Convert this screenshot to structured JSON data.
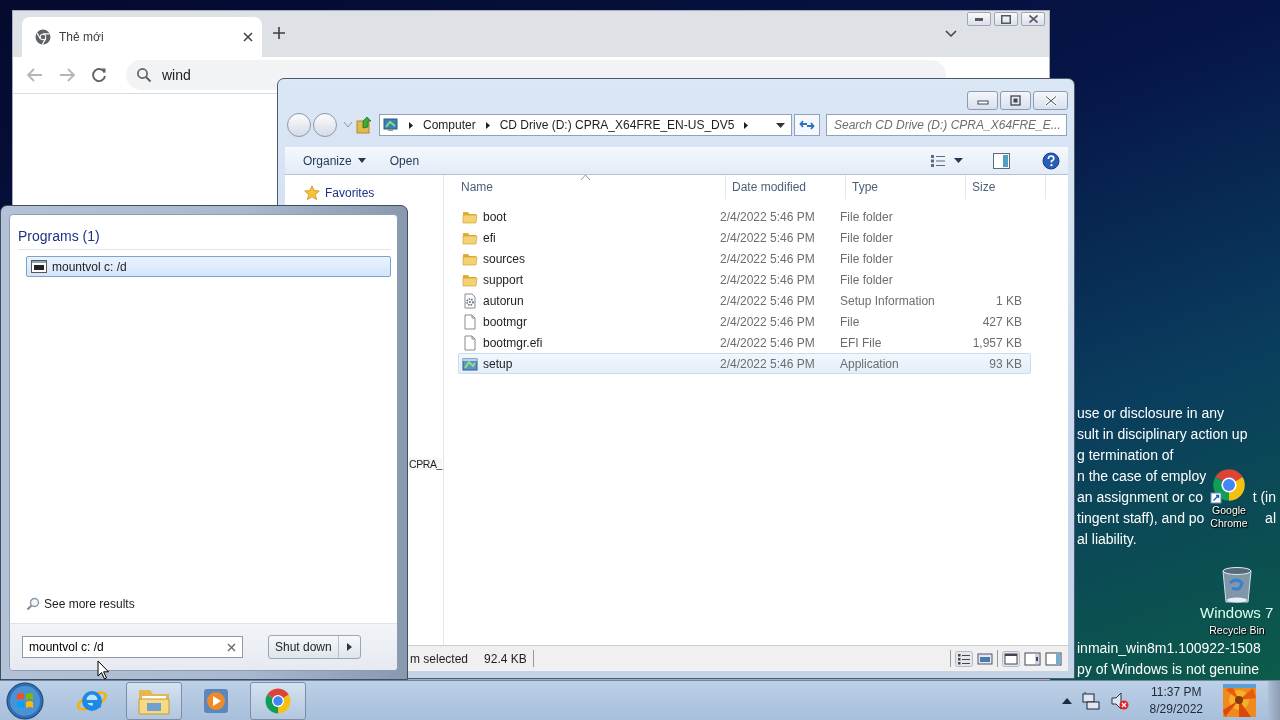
{
  "desktop": {
    "notice_lines": [
      [
        "use or disclosure in any"
      ],
      [
        "sult in disciplinary action up"
      ],
      [
        "g termination of"
      ],
      [
        "n the case of employ"
      ],
      [
        "an assignment or co",
        "t (in"
      ],
      [
        "tingent staff), and po",
        "al"
      ],
      [
        "al liability."
      ]
    ],
    "icons": [
      {
        "kind": "chrome",
        "label": "Google Chrome"
      },
      {
        "kind": "recycle-bin",
        "label": "Recycle Bin"
      }
    ],
    "edition": "Windows 7",
    "build_lines": [
      "inmain_win8m1.100922-1508",
      "py of Windows is not genuine"
    ]
  },
  "browser": {
    "tab_title": "Thẻ mới",
    "address": "wind"
  },
  "explorer": {
    "breadcrumbs": [
      "Computer",
      "CD Drive (D:) CPRA_X64FRE_EN-US_DV5"
    ],
    "search_placeholder": "Search CD Drive (D:) CPRA_X64FRE_E...",
    "commands": [
      {
        "label": "Organize",
        "menu": true
      },
      {
        "label": "Open",
        "menu": false
      }
    ],
    "nav_items": [
      "Favorites",
      "CPRA_"
    ],
    "columns": [
      "Name",
      "Date modified",
      "Type",
      "Size"
    ],
    "rows": [
      {
        "kind": "folder",
        "name": "boot",
        "date": "2/4/2022 5:46 PM",
        "type": "File folder",
        "selected": false
      },
      {
        "kind": "folder",
        "name": "efi",
        "date": "2/4/2022 5:46 PM",
        "type": "File folder",
        "selected": false
      },
      {
        "kind": "folder",
        "name": "sources",
        "date": "2/4/2022 5:46 PM",
        "type": "File folder",
        "selected": false
      },
      {
        "kind": "folder",
        "name": "support",
        "date": "2/4/2022 5:46 PM",
        "type": "File folder",
        "selected": false
      },
      {
        "kind": "settings",
        "name": "autorun",
        "date": "2/4/2022 5:46 PM",
        "type": "Setup Information",
        "size": "1 KB",
        "selected": false
      },
      {
        "kind": "file",
        "name": "bootmgr",
        "date": "2/4/2022 5:46 PM",
        "type": "File",
        "size": "427 KB",
        "selected": false
      },
      {
        "kind": "file",
        "name": "bootmgr.efi",
        "date": "2/4/2022 5:46 PM",
        "type": "EFI File",
        "size": "1,957 KB",
        "selected": false
      },
      {
        "kind": "app",
        "name": "setup",
        "date": "2/4/2022 5:46 PM",
        "type": "Application",
        "size": "93 KB",
        "selected": true
      }
    ],
    "status": "m selected",
    "status_size": "92.4 KB"
  },
  "start_menu": {
    "group": "Programs (1)",
    "results": [
      {
        "label": "mountvol c: /d",
        "selected": true
      }
    ],
    "see_more": "See more results",
    "search_value": "mountvol c: /d",
    "shutdown": "Shut down"
  },
  "taskbar": {
    "apps": [
      {
        "kind": "ie",
        "active": false
      },
      {
        "kind": "explorer",
        "active": true
      },
      {
        "kind": "media",
        "active": false
      },
      {
        "kind": "chrome",
        "active": true
      }
    ],
    "time": "11:37 PM",
    "date": "8/29/2022"
  }
}
